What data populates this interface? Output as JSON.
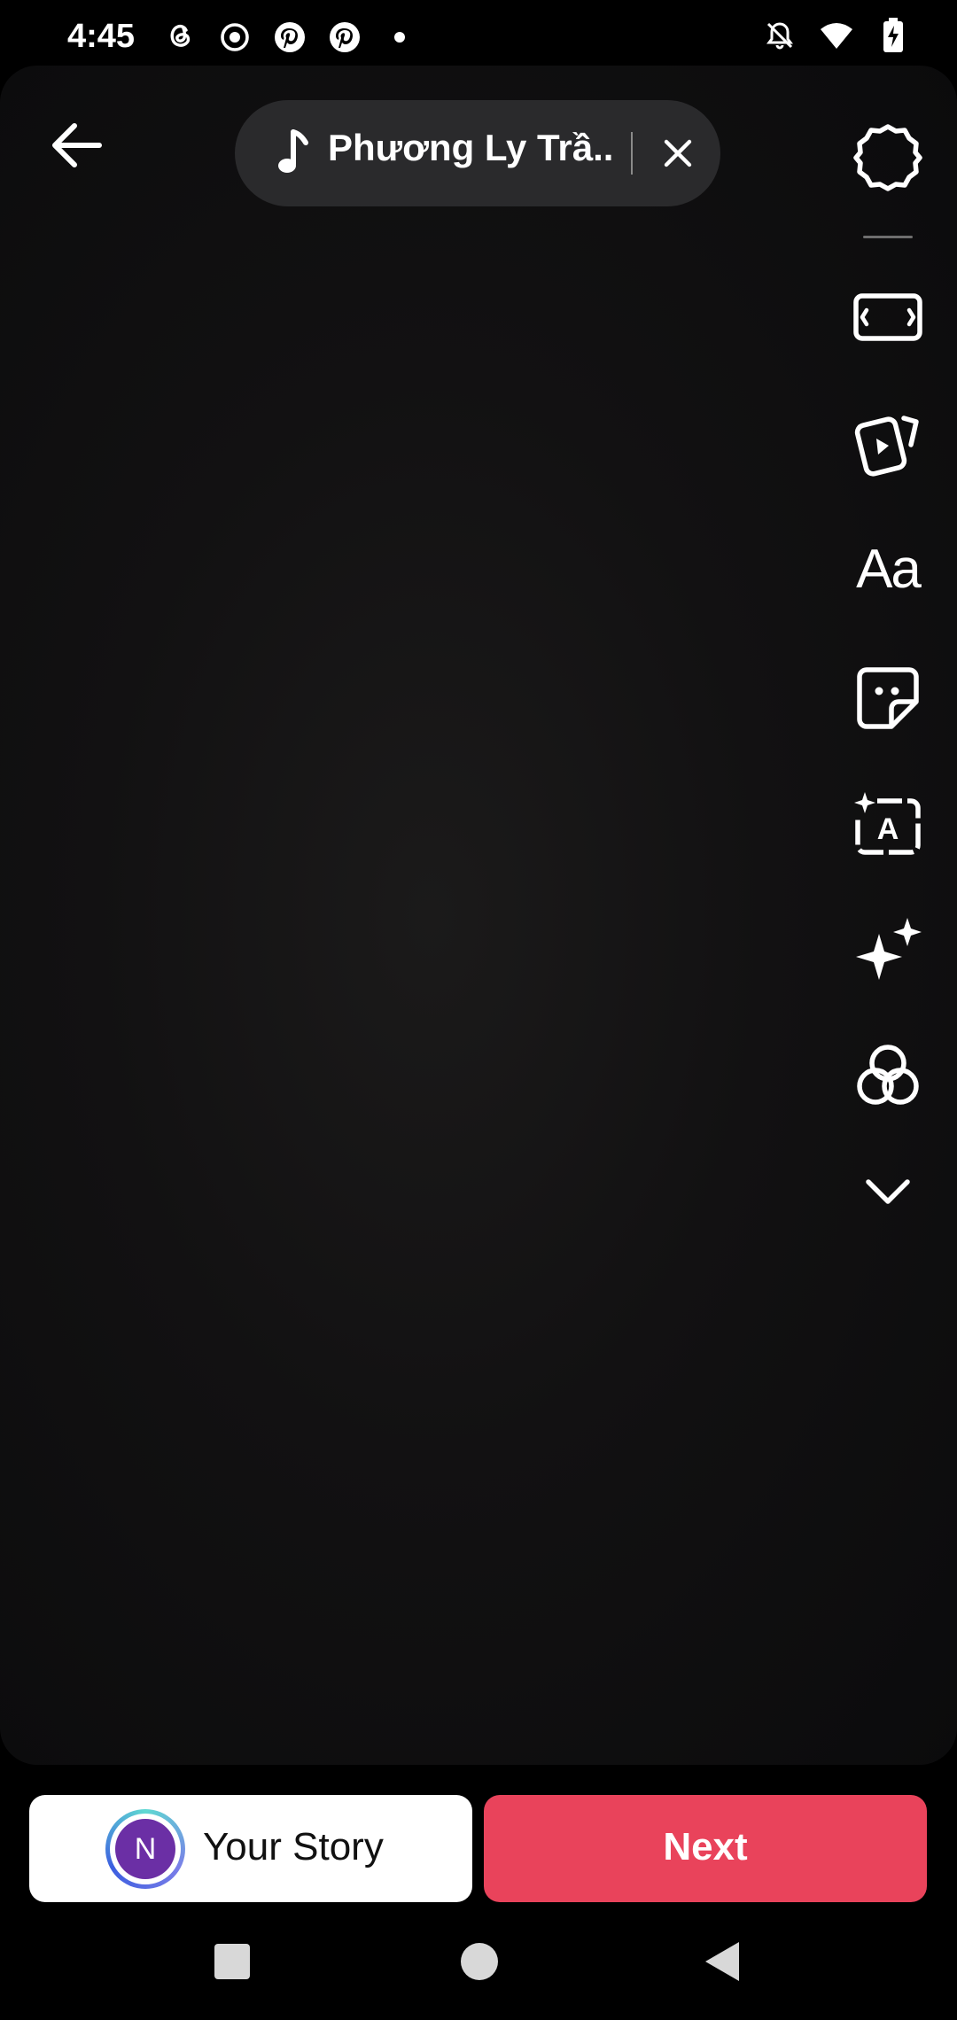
{
  "status_bar": {
    "time": "4:45",
    "left_icons": [
      "threads-icon",
      "record-icon",
      "pinterest-icon",
      "pinterest-icon",
      "dot-icon"
    ],
    "right_icons": [
      "bell-off-icon",
      "wifi-icon",
      "battery-charging-icon"
    ]
  },
  "editor": {
    "music": {
      "song_title": "Phương Ly Trầ..."
    },
    "tools": [
      "settings-icon",
      "aspect-ratio-icon",
      "media-clip-icon",
      "text-icon",
      "sticker-icon",
      "auto-caption-icon",
      "effects-sparkle-icon",
      "filters-icon",
      "chevron-down-icon"
    ],
    "text_tool_label": "Aa"
  },
  "bottom": {
    "avatar_initial": "N",
    "story_label": "Your Story",
    "next_label": "Next",
    "accent_color": "#e9435b"
  }
}
